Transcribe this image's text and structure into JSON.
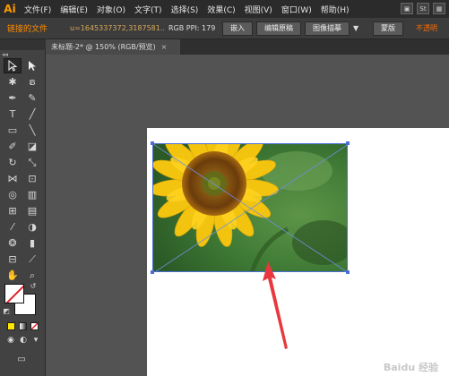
{
  "app": {
    "logo": "Ai"
  },
  "menu": {
    "items": [
      "文件(F)",
      "编辑(E)",
      "对象(O)",
      "文字(T)",
      "选择(S)",
      "效果(C)",
      "视图(V)",
      "窗口(W)",
      "帮助(H)"
    ],
    "right_box": "St"
  },
  "control": {
    "linked_label": "链接的文件",
    "file_name": "u=1645337372,3187581...",
    "color_info": "RGB PPI: 179",
    "embed_button": "嵌入",
    "edit_original_button": "编辑原稿",
    "image_trace_button": "图像描摹",
    "mask_button": "蒙版",
    "opacity_label": "不透明"
  },
  "document": {
    "tab_title": "未标题-2* @ 150% (RGB/预览)",
    "close": "×"
  },
  "watermark": {
    "text": "Baidu 经验"
  },
  "colors": {
    "menubar": "#2b2b2b",
    "control": "#3c3c3c",
    "canvas": "#535353",
    "selection": "#4a6fd6",
    "arrow": "#e8383d"
  }
}
